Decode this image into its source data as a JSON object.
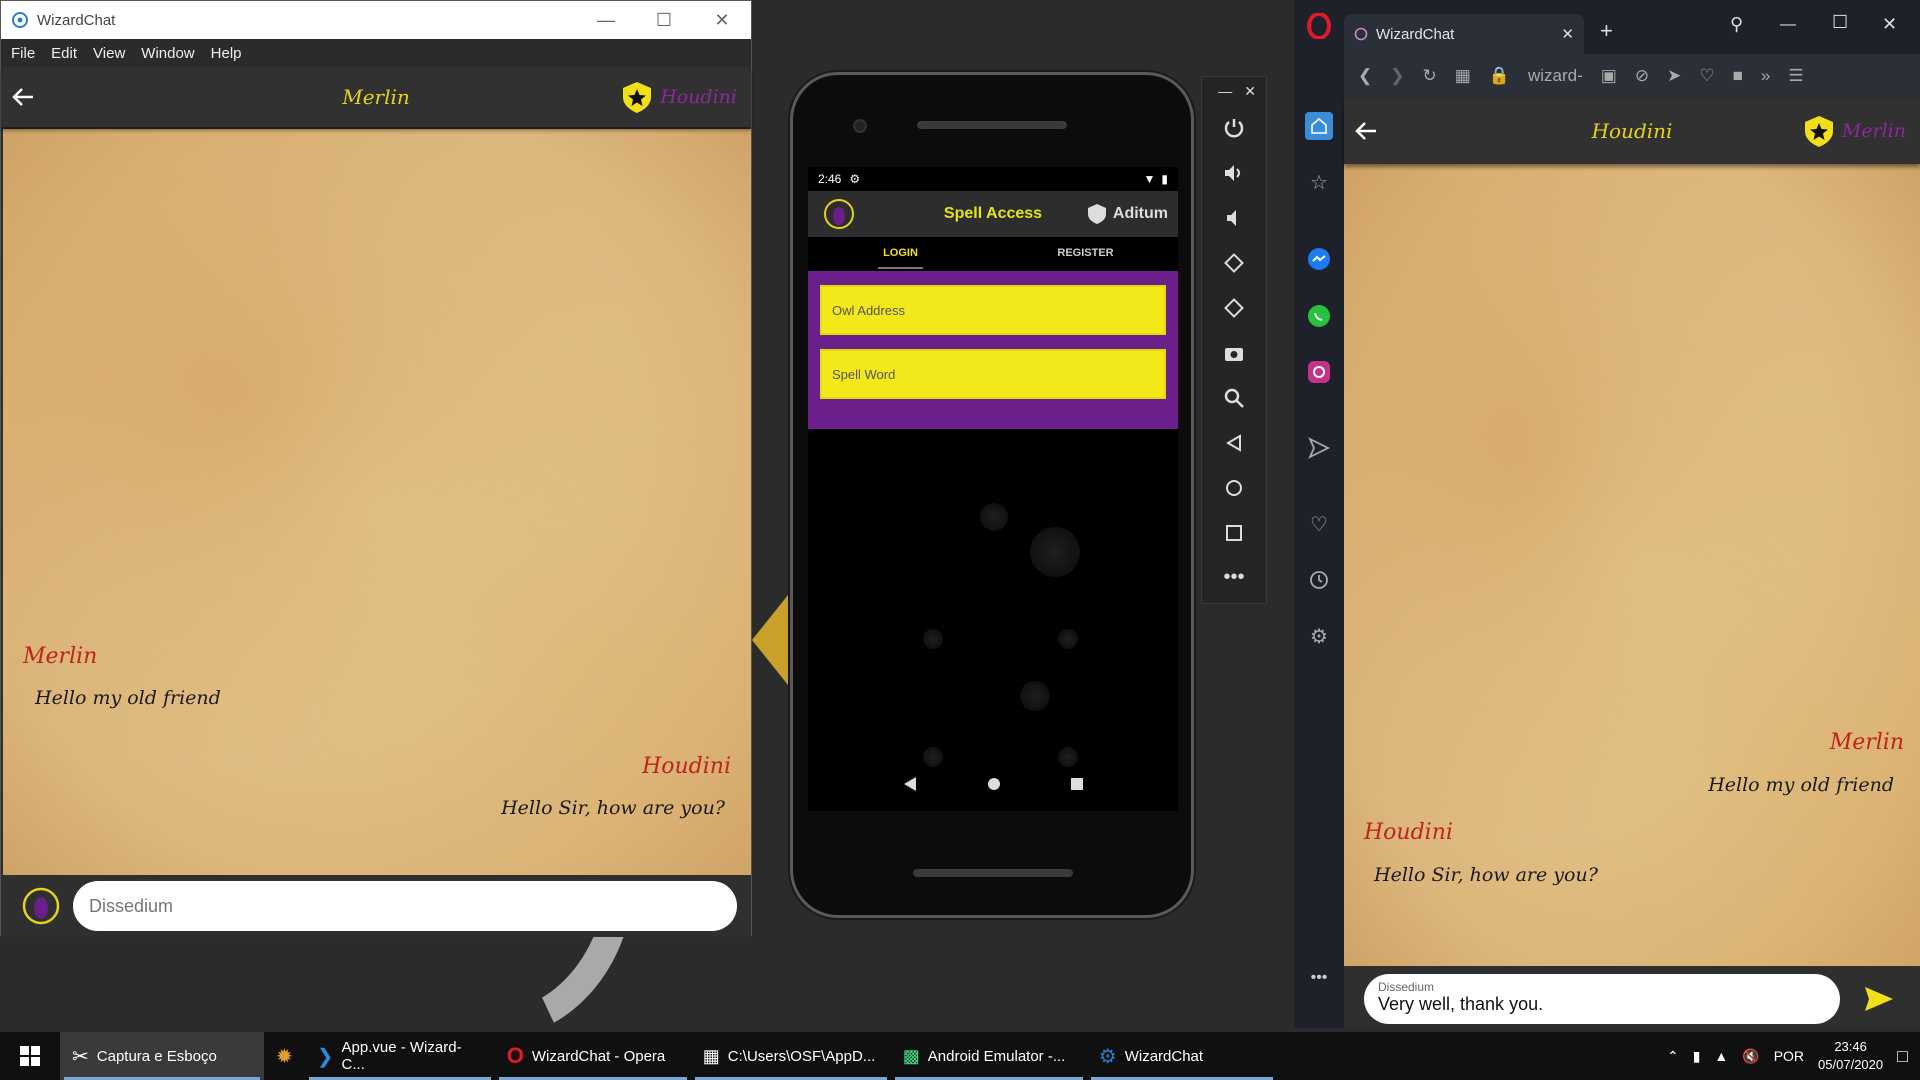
{
  "electron": {
    "title": "WizardChat",
    "menu": [
      "File",
      "Edit",
      "View",
      "Window",
      "Help"
    ],
    "header_name": "Merlin",
    "header_other": "Houdini",
    "messages": [
      {
        "name": "Merlin",
        "text": "Hello my old friend"
      },
      {
        "name": "Houdini",
        "text": "Hello Sir, how are you?"
      }
    ],
    "input_placeholder": "Dissedium"
  },
  "phone": {
    "time": "2:46",
    "header_title": "Spell Access",
    "header_right": "Aditum",
    "tabs": [
      "LOGIN",
      "REGISTER"
    ],
    "fields": [
      "Owl Address",
      "Spell Word"
    ]
  },
  "opera": {
    "tab_title": "WizardChat",
    "address": "wizard-",
    "header_name": "Houdini",
    "header_other": "Merlin",
    "messages": [
      {
        "name": "Merlin",
        "text": "Hello my old friend"
      },
      {
        "name": "Houdini",
        "text": "Hello Sir, how are you?"
      }
    ],
    "input_label": "Dissedium",
    "input_value": "Very well, thank you."
  },
  "taskbar": {
    "items": [
      "Captura e Esboço",
      "App.vue - Wizard-C...",
      "WizardChat - Opera",
      "C:\\Users\\OSF\\AppD...",
      "Android Emulator -...",
      "WizardChat"
    ],
    "lang": "POR",
    "time": "23:46",
    "date": "05/07/2020"
  },
  "colors": {
    "accent_yellow": "#e4d31a",
    "accent_purple": "#6a1f8a",
    "name_red": "#c0231e"
  }
}
